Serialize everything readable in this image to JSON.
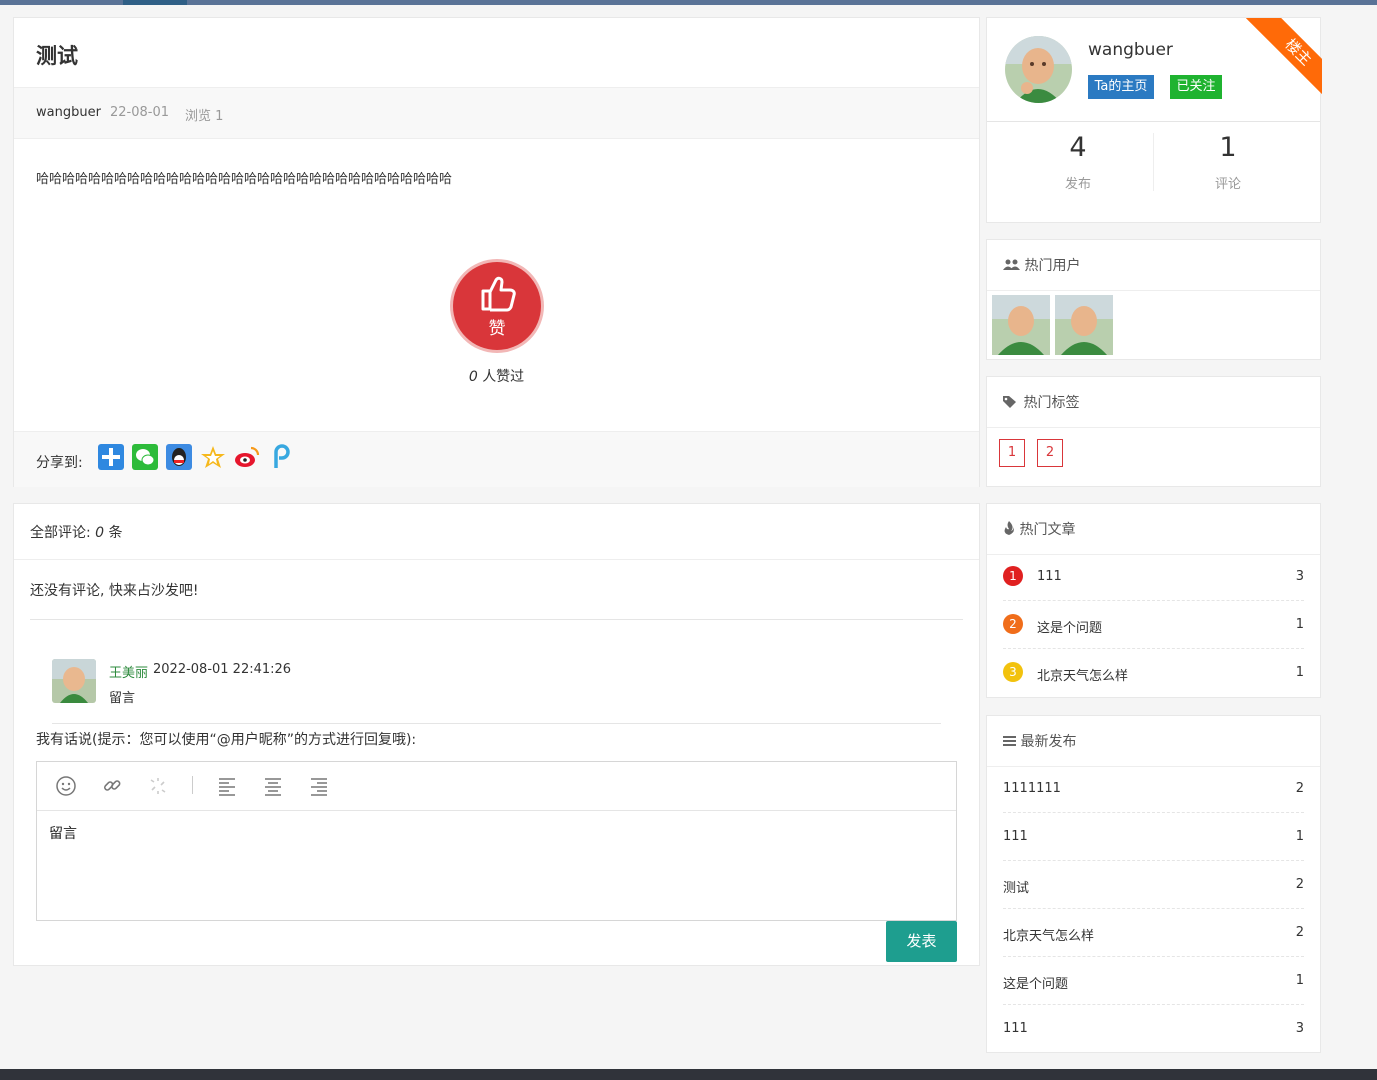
{
  "article": {
    "title": "测试",
    "author": "wangbuer",
    "date": "22-08-01",
    "views": "浏览 1",
    "content": "哈哈哈哈哈哈哈哈哈哈哈哈哈哈哈哈哈哈哈哈哈哈哈哈哈哈哈哈哈哈哈哈",
    "like_label": "赞",
    "like_count": "0",
    "like_suffix": "人赞过",
    "share_label": "分享到:"
  },
  "comments": {
    "header_prefix": "全部评论:",
    "count": "0",
    "header_suffix": "条",
    "empty_text": "还没有评论, 快来占沙发吧!",
    "reply_name": "王美丽",
    "reply_time": "2022-08-01 22:41:26",
    "reply_text": "留言",
    "prompt": "我有话说(提示：您可以使用“@用户昵称”的方式进行回复哦):",
    "editor_content": "留言",
    "submit_label": "发表"
  },
  "user": {
    "name": "wangbuer",
    "home_button": "Ta的主页",
    "follow_button": "已关注",
    "ribbon": "楼主",
    "stats": [
      {
        "value": "4",
        "label": "发布"
      },
      {
        "value": "1",
        "label": "评论"
      }
    ]
  },
  "hot_users": {
    "title": "热门用户"
  },
  "hot_tags": {
    "title": "热门标签",
    "tags": [
      "1",
      "2"
    ]
  },
  "hot_articles": {
    "title": "热门文章",
    "items": [
      {
        "rank": "1",
        "title": "111",
        "count": "3",
        "color": "#e02020"
      },
      {
        "rank": "2",
        "title": "这是个问题",
        "count": "1",
        "color": "#f06d1a"
      },
      {
        "rank": "3",
        "title": "北京天气怎么样",
        "count": "1",
        "color": "#f2c20e"
      }
    ]
  },
  "latest": {
    "title": "最新发布",
    "items": [
      {
        "title": "1111111",
        "count": "2"
      },
      {
        "title": "111",
        "count": "1"
      },
      {
        "title": "测试",
        "count": "2"
      },
      {
        "title": "北京天气怎么样",
        "count": "2"
      },
      {
        "title": "这是个问题",
        "count": "1"
      },
      {
        "title": "111",
        "count": "3"
      }
    ]
  },
  "icons": {
    "share": [
      "share-more-icon",
      "wechat-icon",
      "qq-icon",
      "qzone-icon",
      "weibo-icon",
      "pengyou-icon"
    ],
    "toolbar": [
      "emoji-icon",
      "link-icon",
      "unlink-icon",
      "align-left-icon",
      "align-center-icon",
      "align-right-icon"
    ]
  },
  "colors": {
    "accent": "#1e9e8f",
    "like": "#d9363a",
    "follow": "#1fb330",
    "home": "#2b7ac2",
    "ribbon": "#ff6a08"
  }
}
